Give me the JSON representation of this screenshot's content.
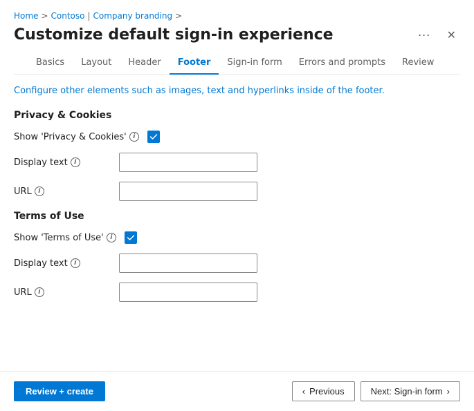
{
  "breadcrumb": {
    "home": "Home",
    "separator1": ">",
    "contoso": "Contoso",
    "separator2": "|",
    "companyBranding": "Company branding",
    "separator3": ">"
  },
  "title": "Customize default sign-in experience",
  "tabs": [
    {
      "id": "basics",
      "label": "Basics",
      "active": false
    },
    {
      "id": "layout",
      "label": "Layout",
      "active": false
    },
    {
      "id": "header",
      "label": "Header",
      "active": false
    },
    {
      "id": "footer",
      "label": "Footer",
      "active": true
    },
    {
      "id": "signin-form",
      "label": "Sign-in form",
      "active": false
    },
    {
      "id": "errors-prompts",
      "label": "Errors and prompts",
      "active": false
    },
    {
      "id": "review",
      "label": "Review",
      "active": false
    }
  ],
  "info_text": "Configure other elements such as images, text and hyperlinks inside of the footer.",
  "privacy_section": {
    "title": "Privacy & Cookies",
    "show_label": "Show 'Privacy & Cookies'",
    "show_checked": true,
    "display_text_label": "Display text",
    "display_text_placeholder": "",
    "url_label": "URL",
    "url_placeholder": ""
  },
  "terms_section": {
    "title": "Terms of Use",
    "show_label": "Show 'Terms of Use'",
    "show_checked": true,
    "display_text_label": "Display text",
    "display_text_placeholder": "",
    "url_label": "URL",
    "url_placeholder": ""
  },
  "footer": {
    "review_create_label": "Review + create",
    "previous_label": "Previous",
    "next_label": "Next: Sign-in form"
  },
  "icons": {
    "ellipsis": "···",
    "close": "✕",
    "chevron_left": "‹",
    "chevron_right": "›",
    "info": "i",
    "checkmark": "✓"
  }
}
